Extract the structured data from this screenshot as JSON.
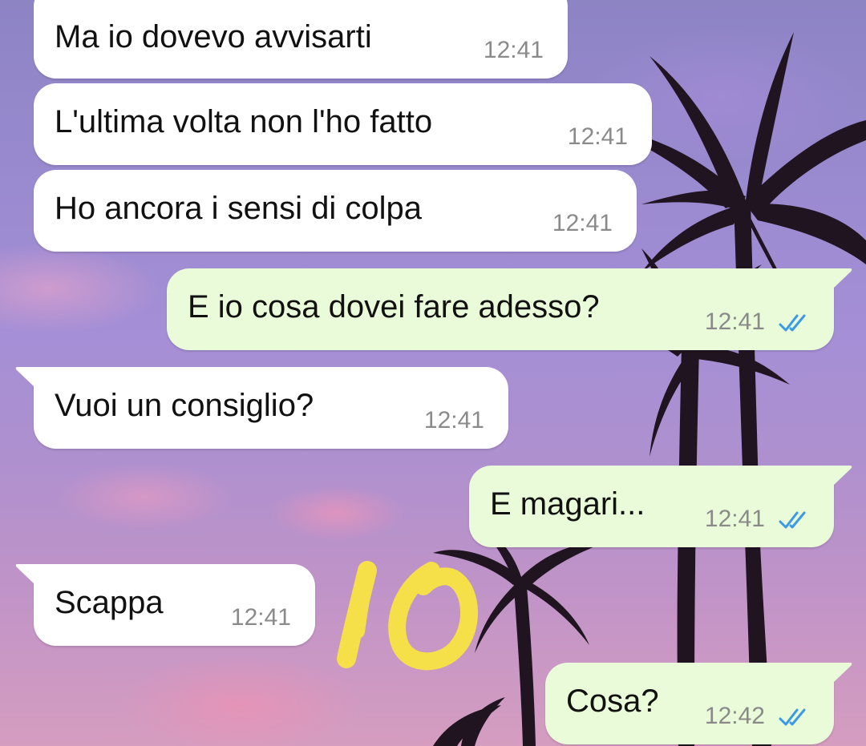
{
  "chat": {
    "messages": [
      {
        "direction": "incoming",
        "text": "Ma io dovevo avvisarti",
        "time": "12:41"
      },
      {
        "direction": "incoming",
        "text": "L'ultima volta non l'ho fatto",
        "time": "12:41"
      },
      {
        "direction": "incoming",
        "text": "Ho ancora i sensi di colpa",
        "time": "12:41"
      },
      {
        "direction": "outgoing",
        "text": "E io cosa dovei fare adesso?",
        "time": "12:41",
        "status": "read-double-check"
      },
      {
        "direction": "incoming",
        "text": "Vuoi un consiglio?",
        "time": "12:41"
      },
      {
        "direction": "outgoing",
        "text": "E magari...",
        "time": "12:41",
        "status": "read-double-check"
      },
      {
        "direction": "incoming",
        "text": "Scappa",
        "time": "12:41"
      },
      {
        "direction": "outgoing",
        "text": "Cosa?",
        "time": "12:42",
        "status": "read-double-check"
      }
    ]
  },
  "overlay": {
    "annotation_text": "10",
    "annotation_color": "#f5e04a"
  },
  "colors": {
    "incoming_bubble": "#ffffff",
    "outgoing_bubble": "#e9fbd8",
    "timestamp": "#8a8a8a",
    "read_ticks": "#3b9ae8"
  },
  "icons": {
    "read_status": "double-check-icon"
  }
}
